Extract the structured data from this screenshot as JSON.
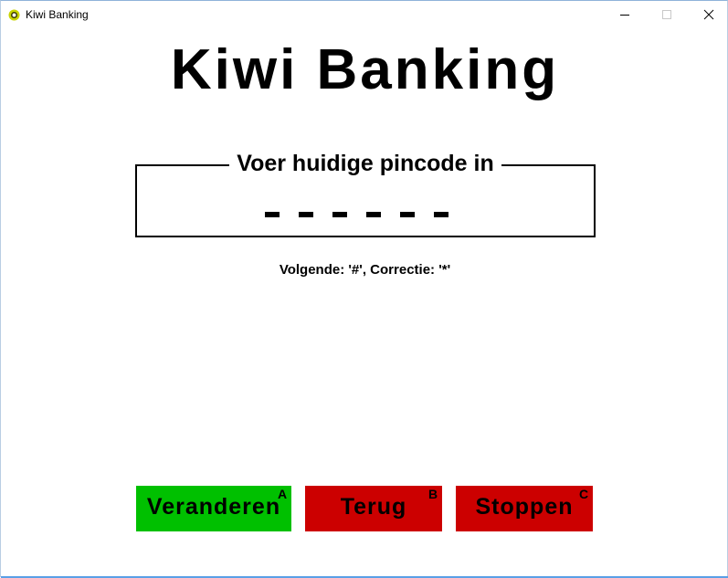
{
  "window": {
    "title": "Kiwi Banking",
    "icon": "kiwi-app-icon",
    "controls": [
      "minimize",
      "maximize",
      "close"
    ]
  },
  "main": {
    "heading": "Kiwi Banking",
    "pin_prompt": "Voer huidige pincode in",
    "pin_slots": 6,
    "pin_entered": 0,
    "hint": "Volgende: '#', Correctie: '*'"
  },
  "buttons": [
    {
      "label": "Veranderen",
      "key": "A",
      "color": "#00c000"
    },
    {
      "label": "Terug",
      "key": "B",
      "color": "#cc0000"
    },
    {
      "label": "Stoppen",
      "key": "C",
      "color": "#cc0000"
    }
  ]
}
